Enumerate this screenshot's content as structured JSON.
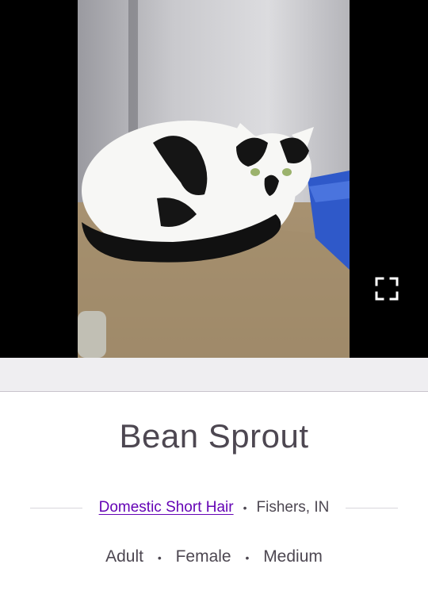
{
  "hero": {
    "photo_alt": "Bean Sprout",
    "expand_icon": "expand-fullscreen-icon"
  },
  "pet": {
    "name": "Bean Sprout",
    "breed": "Domestic Short Hair",
    "location": "Fishers, IN",
    "age": "Adult",
    "sex": "Female",
    "size": "Medium",
    "separator": "•"
  },
  "colors": {
    "link": "#6504b5",
    "text": "#4d4751",
    "band": "#efeef1"
  }
}
